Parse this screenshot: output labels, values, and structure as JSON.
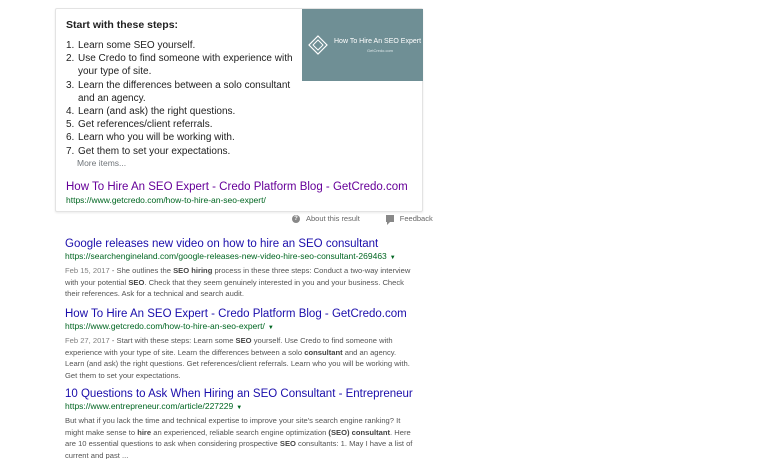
{
  "snippet": {
    "heading": "Start with these steps:",
    "steps": [
      {
        "num": "1.",
        "text": "Learn some SEO yourself."
      },
      {
        "num": "2.",
        "text": "Use Credo to find someone with experience with your type of site."
      },
      {
        "num": "3.",
        "text": "Learn the differences between a solo consultant and an agency."
      },
      {
        "num": "4.",
        "text": "Learn (and ask) the right questions."
      },
      {
        "num": "5.",
        "text": "Get references/client referrals."
      },
      {
        "num": "6.",
        "text": "Learn who you will be working with."
      },
      {
        "num": "7.",
        "text": "Get them to set your expectations."
      }
    ],
    "more_items": "More items...",
    "thumbnail": {
      "title": "How To Hire An SEO Expert",
      "subtitle": "GetCredo.com",
      "bg_color": "#6f8f95"
    },
    "link_title": "How To Hire An SEO Expert - Credo Platform Blog - GetCredo.com",
    "link_url": "https://www.getcredo.com/how-to-hire-an-seo-expert/"
  },
  "feedback_row": {
    "about": "About this result",
    "feedback": "Feedback"
  },
  "results": [
    {
      "title": "Google releases new video on how to hire an SEO consultant",
      "url": "https://searchengineland.com/google-releases-new-video-hire-seo-consultant-269463",
      "date": "Feb 15, 2017",
      "desc_parts": [
        {
          "t": " - She outlines the ",
          "b": false
        },
        {
          "t": "SEO hiring",
          "b": true
        },
        {
          "t": " process in these three steps: Conduct a two-way interview with your potential ",
          "b": false
        },
        {
          "t": "SEO",
          "b": true
        },
        {
          "t": ". Check that they seem genuinely interested in you and your business. Check their references. Ask for a technical and search audit.",
          "b": false
        }
      ]
    },
    {
      "title": "How To Hire An SEO Expert - Credo Platform Blog - GetCredo.com",
      "url": "https://www.getcredo.com/how-to-hire-an-seo-expert/",
      "date": "Feb 27, 2017",
      "desc_parts": [
        {
          "t": " - Start with these steps: Learn some ",
          "b": false
        },
        {
          "t": "SEO",
          "b": true
        },
        {
          "t": " yourself. Use Credo to find someone with experience with your type of site. Learn the differences between a solo ",
          "b": false
        },
        {
          "t": "consultant",
          "b": true
        },
        {
          "t": " and an agency. Learn (and ask) the right questions. Get references/client referrals. Learn who you will be working with. Get them to set your expectations.",
          "b": false
        }
      ]
    },
    {
      "title": "10 Questions to Ask When Hiring an SEO Consultant - Entrepreneur",
      "url": "https://www.entrepreneur.com/article/227229",
      "date": "",
      "desc_parts": [
        {
          "t": "But what if you lack the time and technical expertise to improve your site's search engine ranking? It might make sense to ",
          "b": false
        },
        {
          "t": "hire",
          "b": true
        },
        {
          "t": " an experienced, reliable search engine optimization ",
          "b": false
        },
        {
          "t": "(SEO) consultant",
          "b": true
        },
        {
          "t": ". Here are 10 essential questions to ask when considering prospective ",
          "b": false
        },
        {
          "t": "SEO",
          "b": true
        },
        {
          "t": " consultants: 1. May I have a list of current and past ...",
          "b": false
        }
      ]
    }
  ]
}
